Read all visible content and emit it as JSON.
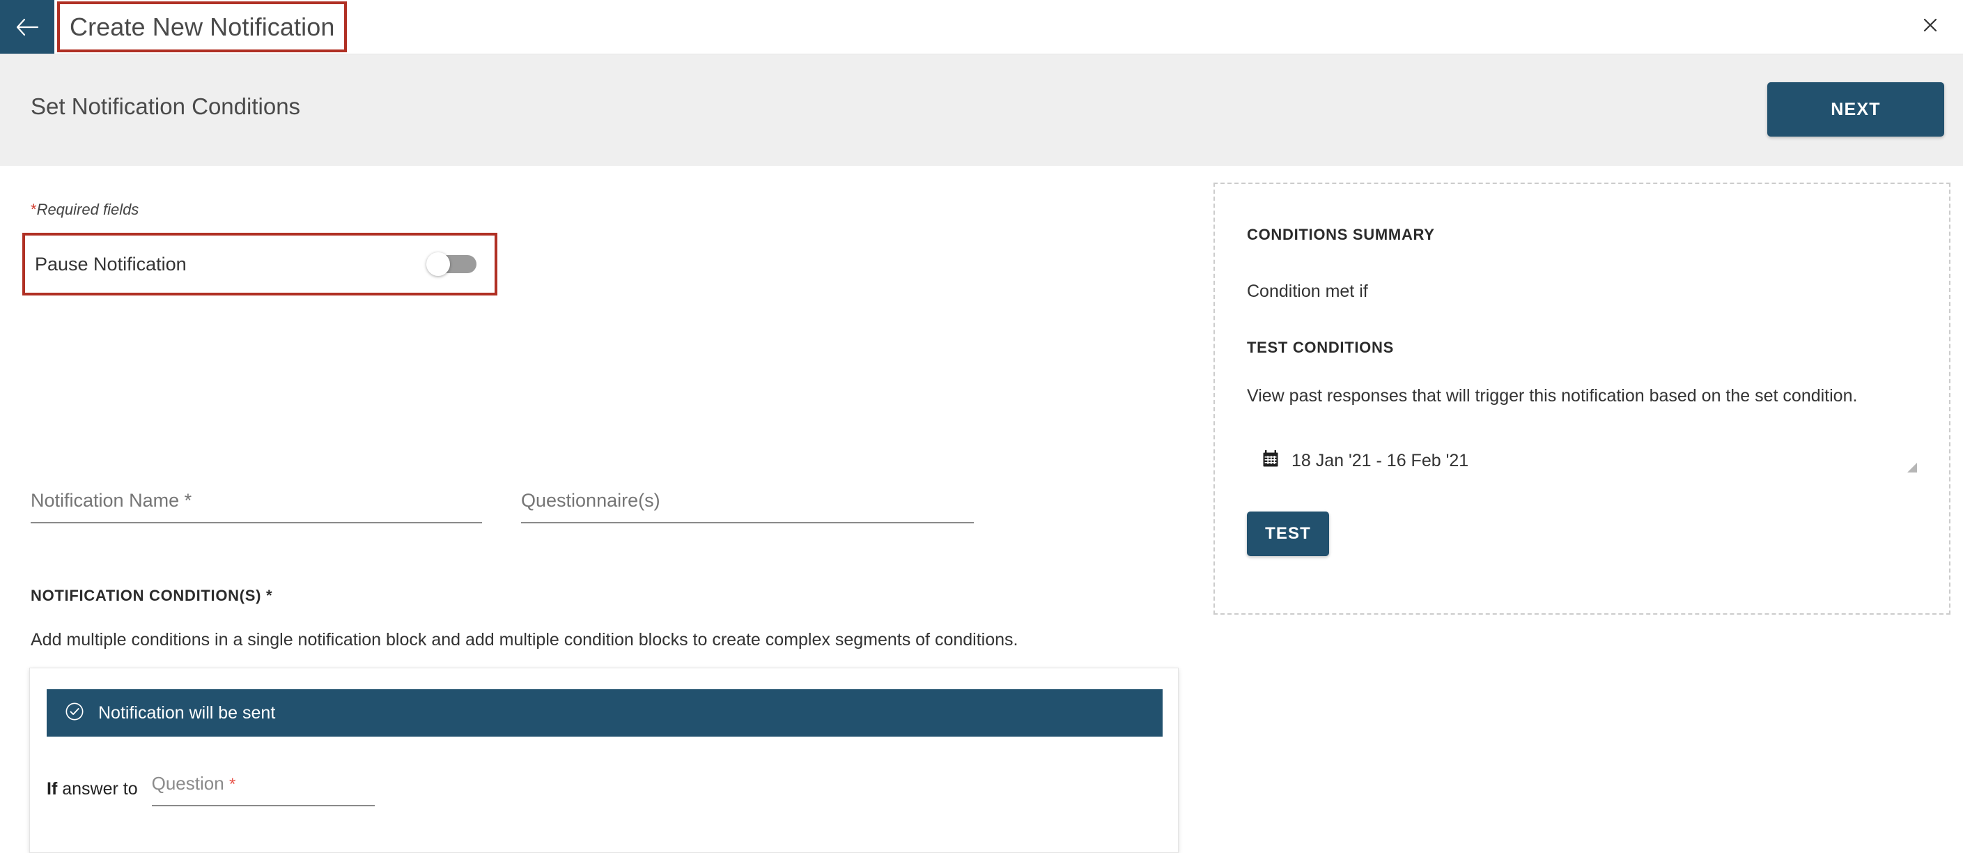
{
  "window": {
    "title": "Create New Notification",
    "back_icon": "arrow-left-icon",
    "close_icon": "close-icon"
  },
  "subheader": {
    "heading": "Set Notification Conditions",
    "next_label": "NEXT"
  },
  "form": {
    "required_note_asterisk": "*",
    "required_note": "Required fields",
    "pause": {
      "label": "Pause Notification",
      "toggle_state": "off"
    },
    "fields": [
      {
        "label": "Notification Name",
        "required_mark": " *",
        "value": "",
        "placeholder": "Notification Name *"
      },
      {
        "label": "Questionnaire(s)",
        "required_mark": "",
        "value": "",
        "placeholder": "Questionnaire(s)"
      }
    ],
    "conditions_section": {
      "label": "NOTIFICATION CONDITION(S) *",
      "description": "Add multiple conditions in a single notification block and add multiple condition blocks to create complex segments of conditions.",
      "block": {
        "banner_icon": "check-circle-icon",
        "banner_text": "Notification will be sent",
        "if_prefix_bold": "If",
        "if_prefix_rest": " answer to",
        "question_label": "Question",
        "question_required_mark": "*",
        "question_value": ""
      }
    }
  },
  "summary_panel": {
    "title": "CONDITIONS SUMMARY",
    "condition_met": "Condition met if",
    "test_title": "TEST CONDITIONS",
    "test_description": "View past responses that will trigger this notification based on the set condition.",
    "calendar_icon": "calendar-icon",
    "date_range": "18 Jan '21 - 16 Feb '21",
    "test_button_label": "TEST"
  },
  "colors": {
    "brand_blue": "#22516e",
    "highlight_red": "#b03024",
    "required_red": "#d0392b",
    "header_gray": "#efefef",
    "toggle_track": "#9b9b9b"
  }
}
